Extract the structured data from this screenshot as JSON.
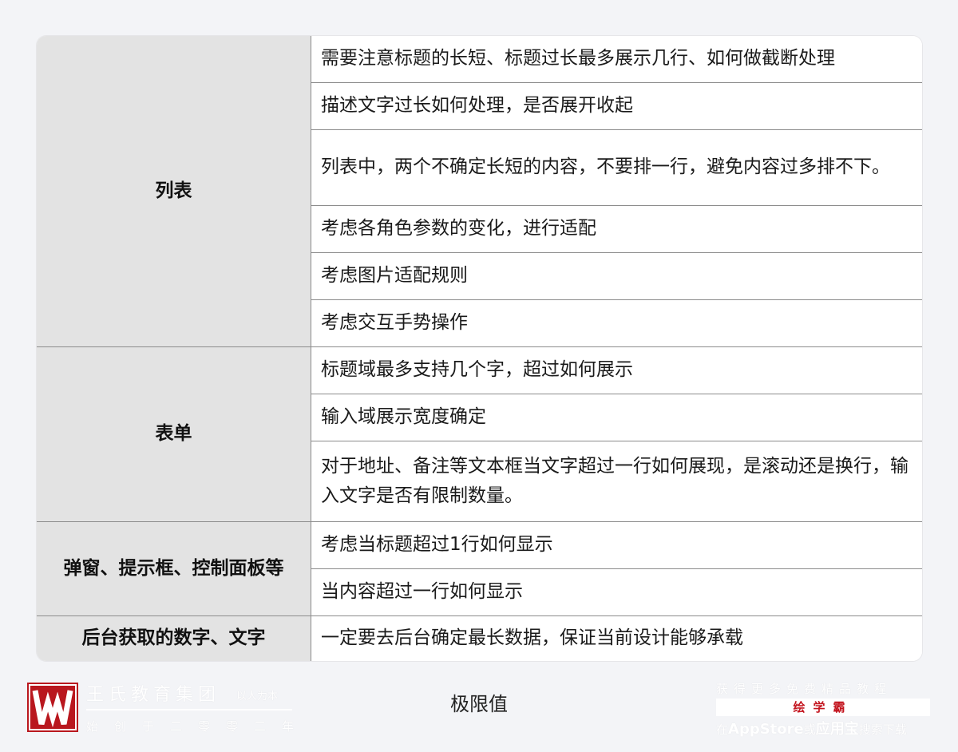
{
  "table": {
    "rows": [
      {
        "category": "列表",
        "items": [
          "需要注意标题的长短、标题过长最多展示几行、如何做截断处理",
          "描述文字过长如何处理，是否展开收起",
          "列表中，两个不确定长短的内容，不要排一行，避免内容过多排不下。",
          "考虑各角色参数的变化，进行适配",
          "考虑图片适配规则",
          "考虑交互手势操作"
        ]
      },
      {
        "category": "表单",
        "items": [
          "标题域最多支持几个字，超过如何展示",
          "输入域展示宽度确定",
          "对于地址、备注等文本框当文字超过一行如何展现，是滚动还是换行，输入文字是否有限制数量。"
        ]
      },
      {
        "category": "弹窗、提示框、控制面板等",
        "items": [
          "考虑当标题超过1行如何显示",
          "当内容超过一行如何显示"
        ]
      },
      {
        "category": "后台获取的数字、文字",
        "items": [
          "一定要去后台确定最长数据，保证当前设计能够承载"
        ]
      }
    ]
  },
  "caption": "极限值",
  "brand": {
    "name": "王氏教育集团",
    "slogan": "以人为本",
    "subline": "始创于二零零二年"
  },
  "promo": {
    "line1": "获得更多免费精品教程",
    "line2": "绘学霸",
    "line3_prefix": "在",
    "line3_app1": "AppStore",
    "line3_mid": "或",
    "line3_app2": "应用宝",
    "line3_suffix": "搜索下载"
  },
  "colors": {
    "category_bg": "#e3e3e3",
    "border": "#8c8c8c",
    "logo_red": "#b9171e"
  }
}
